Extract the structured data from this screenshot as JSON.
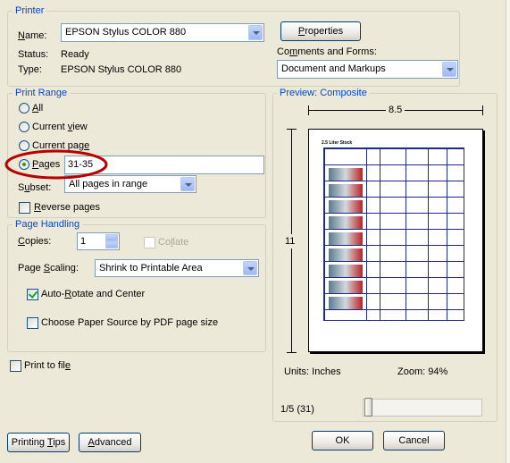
{
  "printer": {
    "legend": "Printer",
    "name_label": "Name:",
    "name_value": "EPSON Stylus COLOR 880",
    "status_label": "Status:",
    "status_value": "Ready",
    "type_label": "Type:",
    "type_value": "EPSON Stylus COLOR 880",
    "properties_button": "Properties",
    "comments_label": "Comments and Forms:",
    "comments_value": "Document and Markups"
  },
  "print_range": {
    "legend": "Print Range",
    "all": "All",
    "current_view": "Current view",
    "current_page": "Current page",
    "pages": "Pages",
    "pages_value": "31-35",
    "selected": "pages",
    "subset_label": "Subset:",
    "subset_value": "All pages in range",
    "reverse": "Reverse pages",
    "reverse_checked": false
  },
  "page_handling": {
    "legend": "Page Handling",
    "copies_label": "Copies:",
    "copies_value": "1",
    "collate": "Collate",
    "scaling_label": "Page Scaling:",
    "scaling_value": "Shrink to Printable Area",
    "auto_rotate": "Auto-Rotate and Center",
    "auto_rotate_checked": true,
    "paper_source": "Choose Paper Source by PDF page size",
    "paper_source_checked": false
  },
  "print_to_file": {
    "label": "Print to file",
    "checked": false
  },
  "preview": {
    "legend": "Preview: Composite",
    "width": "8.5",
    "height": "11",
    "doc_title": "2.5 Liter Stock",
    "units": "Units: Inches",
    "zoom": "Zoom:  94%",
    "page_indicator": "1/5 (31)"
  },
  "buttons": {
    "printing_tips": "Printing Tips",
    "advanced": "Advanced",
    "ok": "OK",
    "cancel": "Cancel"
  },
  "annotation": {
    "color": "#b80000",
    "shape": "ellipse"
  }
}
